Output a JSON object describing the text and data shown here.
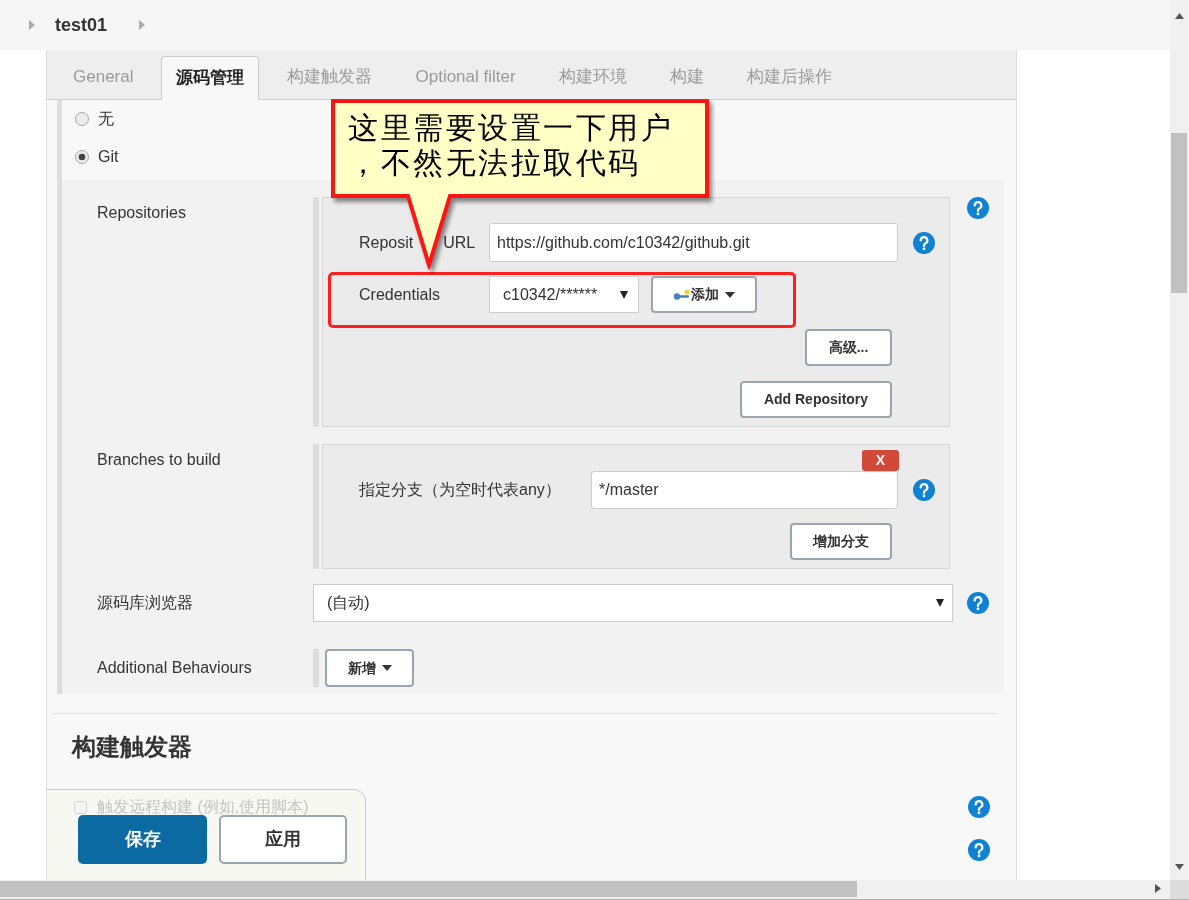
{
  "breadcrumb": [
    "test01"
  ],
  "tabs": [
    {
      "label": "General",
      "selected": false
    },
    {
      "label": "源码管理",
      "selected": true
    },
    {
      "label": "构建触发器",
      "selected": false
    },
    {
      "label": "Optional filter",
      "selected": false
    },
    {
      "label": "构建环境",
      "selected": false
    },
    {
      "label": "构建",
      "selected": false
    },
    {
      "label": "构建后操作",
      "selected": false
    }
  ],
  "scm": {
    "options": [
      {
        "label": "无",
        "selected": false
      },
      {
        "label": "Git",
        "selected": true
      }
    ],
    "repositories": {
      "label": "Repositories",
      "url_label": [
        "Reposit",
        "URL"
      ],
      "url": "https://github.com/c10342/github.git",
      "credentials_label": "Credentials",
      "credentials": "c10342/******",
      "add_button": "添加",
      "advanced_button": "高级...",
      "add_repository_button": "Add Repository"
    },
    "branches": {
      "label": "Branches to build",
      "branch_label": "指定分支（为空时代表any）",
      "branch": "*/master",
      "delete_button": "X",
      "add_branch_button": "增加分支"
    },
    "browser": {
      "label": "源码库浏览器",
      "value": "(自动)"
    },
    "additional_behaviours": {
      "label": "Additional Behaviours",
      "add_button": "新增"
    }
  },
  "triggers": {
    "title": "构建触发器",
    "items": [
      {
        "label": "触发远程构建 (例如,使用脚本)",
        "checked": false
      }
    ]
  },
  "buttons": [
    {
      "label": "保存",
      "kind": "primary"
    },
    {
      "label": "应用",
      "kind": "secondary"
    }
  ],
  "annotations": {
    "callout": [
      "这里需要设置一下用户",
      "，不然无法拉取代码"
    ]
  }
}
